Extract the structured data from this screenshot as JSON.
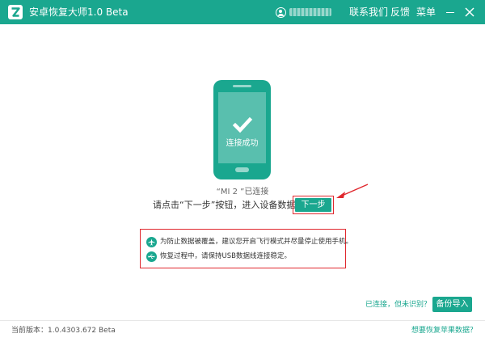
{
  "titlebar": {
    "app_title": "安卓恢复大师1.0 Beta",
    "contact_label": "联系我们",
    "feedback_label": "反馈",
    "menu_label": "菜单"
  },
  "phone": {
    "status_text": "连接成功"
  },
  "device": {
    "name_text": "“MI 2 ”已连接"
  },
  "instruction": {
    "text": "请点击“下一步”按钮，进入设备数据扫描",
    "next_label": "下一步"
  },
  "tips": {
    "items": [
      {
        "icon": "airplane-icon",
        "text": "为防止数据被覆盖，建议您开启飞行模式并尽量停止使用手机。"
      },
      {
        "icon": "usb-icon",
        "text": "恢复过程中，请保持USB数据线连接稳定。"
      }
    ]
  },
  "actions": {
    "not_recognized_label": "已连接，但未识别？",
    "backup_label": "备份导入"
  },
  "footer": {
    "version_text": "当前版本：1.0.4303.672 Beta",
    "apple_link": "想要恢复苹果数据？"
  },
  "colors": {
    "brand": "#1aa78f",
    "highlight": "#e0282e"
  }
}
